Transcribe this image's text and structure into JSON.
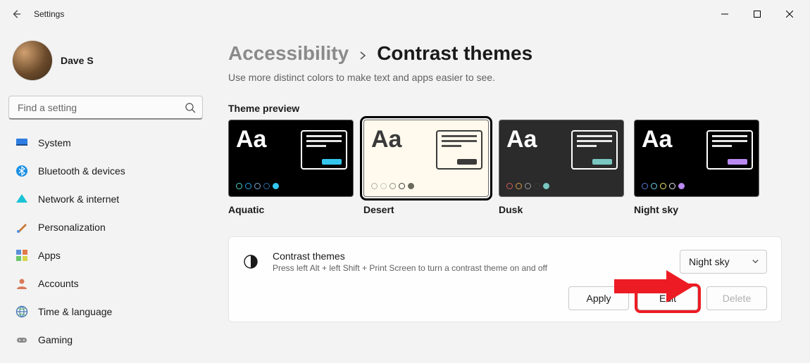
{
  "window": {
    "title": "Settings",
    "user_name": "Dave S",
    "search_placeholder": "Find a setting"
  },
  "sidebar": {
    "items": [
      {
        "label": "System",
        "icon": "display"
      },
      {
        "label": "Bluetooth & devices",
        "icon": "bluetooth"
      },
      {
        "label": "Network & internet",
        "icon": "wifi"
      },
      {
        "label": "Personalization",
        "icon": "brush"
      },
      {
        "label": "Apps",
        "icon": "apps"
      },
      {
        "label": "Accounts",
        "icon": "person"
      },
      {
        "label": "Time & language",
        "icon": "globe"
      },
      {
        "label": "Gaming",
        "icon": "gamepad"
      }
    ]
  },
  "breadcrumb": {
    "parent": "Accessibility",
    "current": "Contrast themes"
  },
  "subtitle": "Use more distinct colors to make text and apps easier to see.",
  "preview_label": "Theme preview",
  "themes": [
    {
      "name": "Aquatic",
      "bg": "#000000",
      "fg": "#ffffff",
      "accent": "#34c6ee",
      "dots": [
        "#4ad0c0",
        "#1aa3e8",
        "#7fa8d2",
        "#2b6aa8",
        "#34c6ee"
      ],
      "selected": false
    },
    {
      "name": "Desert",
      "bg": "#fffaed",
      "fg": "#3a3a3a",
      "accent": "#3a3a3a",
      "dots": [
        "#b0b0a0",
        "#c8c8b8",
        "#909080",
        "#3a3a3a",
        "#6a6a5a"
      ],
      "selected": true
    },
    {
      "name": "Dusk",
      "bg": "#2b2b2b",
      "fg": "#ffffff",
      "accent": "#79c7c0",
      "dots": [
        "#cf5a5a",
        "#d79a4a",
        "#9a9a9a",
        "#3a3a3a",
        "#79c7c0"
      ],
      "selected": false
    },
    {
      "name": "Night sky",
      "bg": "#000000",
      "fg": "#ffffff",
      "accent": "#b98af2",
      "dots": [
        "#5a7ad6",
        "#6ed0f0",
        "#f2e96a",
        "#e8e8e8",
        "#b98af2"
      ],
      "selected": false
    }
  ],
  "setting": {
    "title": "Contrast themes",
    "description": "Press left Alt + left Shift + Print Screen to turn a contrast theme on and off",
    "selected_value": "Night sky"
  },
  "buttons": {
    "apply": "Apply",
    "edit": "Edit",
    "delete": "Delete"
  }
}
